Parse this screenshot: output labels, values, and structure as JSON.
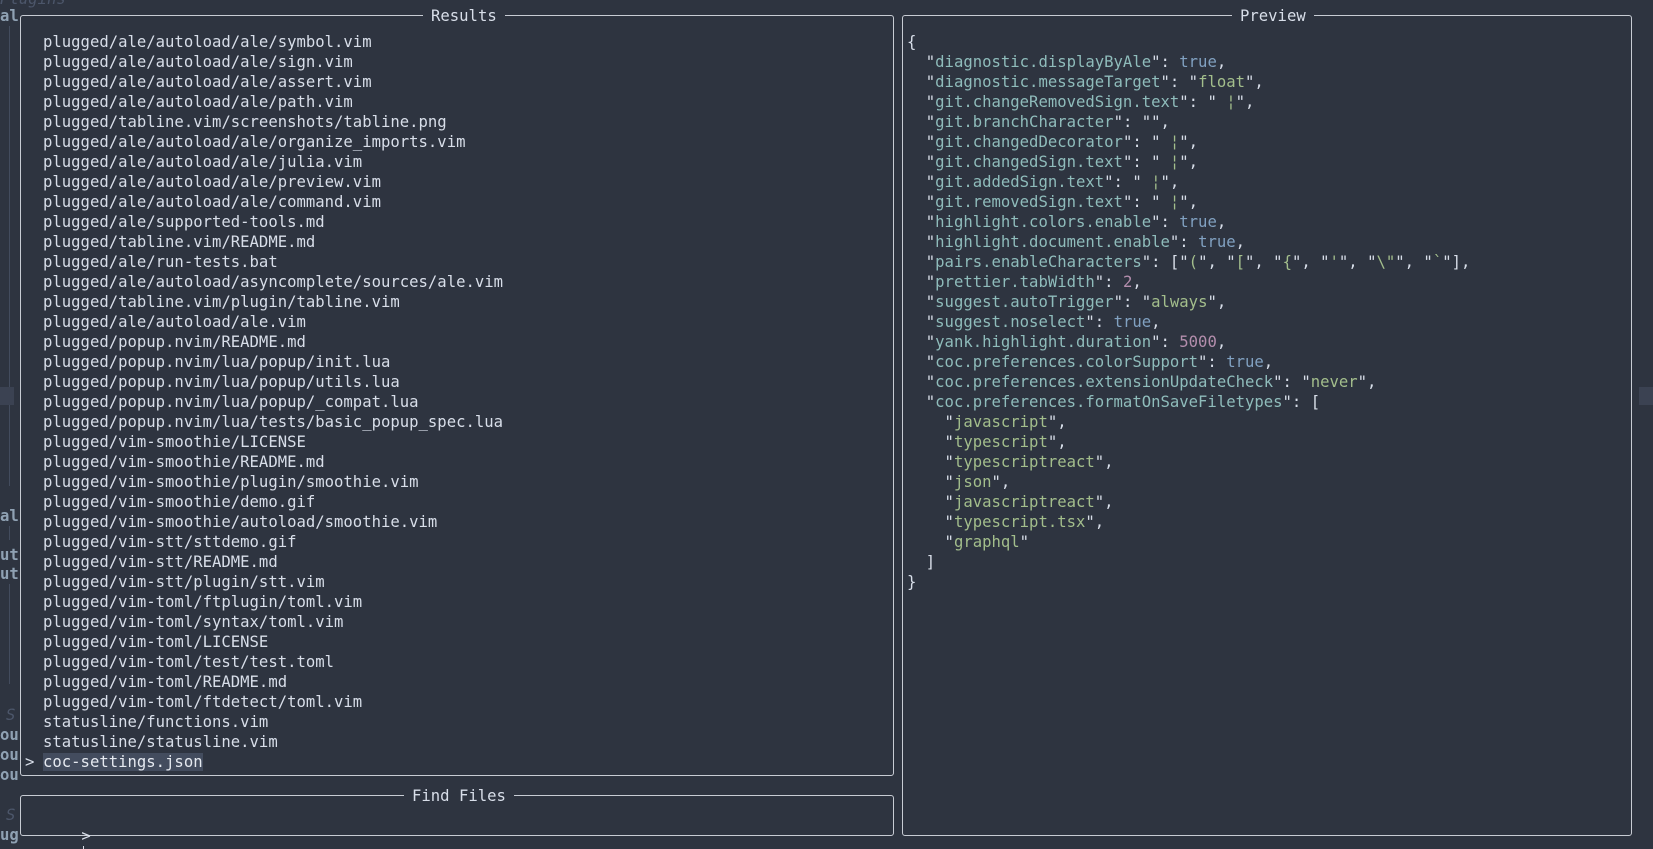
{
  "background_fragments": {
    "top": "Plugins",
    "a": "al",
    "b": "al",
    "c": "ut",
    "d": "ut",
    "e": "S",
    "f": "ou",
    "g": "ou",
    "h": "ou",
    "i": "S",
    "j": "ug"
  },
  "results": {
    "title": "Results",
    "caret": ">",
    "items": [
      "plugged/ale/autoload/ale/symbol.vim",
      "plugged/ale/autoload/ale/sign.vim",
      "plugged/ale/autoload/ale/assert.vim",
      "plugged/ale/autoload/ale/path.vim",
      "plugged/tabline.vim/screenshots/tabline.png",
      "plugged/ale/autoload/ale/organize_imports.vim",
      "plugged/ale/autoload/ale/julia.vim",
      "plugged/ale/autoload/ale/preview.vim",
      "plugged/ale/autoload/ale/command.vim",
      "plugged/ale/supported-tools.md",
      "plugged/tabline.vim/README.md",
      "plugged/ale/run-tests.bat",
      "plugged/ale/autoload/asyncomplete/sources/ale.vim",
      "plugged/tabline.vim/plugin/tabline.vim",
      "plugged/ale/autoload/ale.vim",
      "plugged/popup.nvim/README.md",
      "plugged/popup.nvim/lua/popup/init.lua",
      "plugged/popup.nvim/lua/popup/utils.lua",
      "plugged/popup.nvim/lua/popup/_compat.lua",
      "plugged/popup.nvim/lua/tests/basic_popup_spec.lua",
      "plugged/vim-smoothie/LICENSE",
      "plugged/vim-smoothie/README.md",
      "plugged/vim-smoothie/plugin/smoothie.vim",
      "plugged/vim-smoothie/demo.gif",
      "plugged/vim-smoothie/autoload/smoothie.vim",
      "plugged/vim-stt/sttdemo.gif",
      "plugged/vim-stt/README.md",
      "plugged/vim-stt/plugin/stt.vim",
      "plugged/vim-toml/ftplugin/toml.vim",
      "plugged/vim-toml/syntax/toml.vim",
      "plugged/vim-toml/LICENSE",
      "plugged/vim-toml/test/test.toml",
      "plugged/vim-toml/README.md",
      "plugged/vim-toml/ftdetect/toml.vim",
      "statusline/functions.vim",
      "statusline/statusline.vim",
      "coc-settings.json"
    ],
    "selected_index": 36
  },
  "preview": {
    "title": "Preview",
    "lines": [
      [
        [
          "p",
          "{"
        ]
      ],
      [
        [
          "p",
          "  \""
        ],
        [
          "k",
          "diagnostic.displayByAle"
        ],
        [
          "p",
          "\": "
        ],
        [
          "b",
          "true"
        ],
        [
          "p",
          ","
        ]
      ],
      [
        [
          "p",
          "  \""
        ],
        [
          "k",
          "diagnostic.messageTarget"
        ],
        [
          "p",
          "\": \""
        ],
        [
          "s",
          "float"
        ],
        [
          "p",
          "\","
        ]
      ],
      [
        [
          "p",
          "  \""
        ],
        [
          "k",
          "git.changeRemovedSign.text"
        ],
        [
          "p",
          "\": \""
        ],
        [
          "s",
          " ¦"
        ],
        [
          "p",
          "\","
        ]
      ],
      [
        [
          "p",
          "  \""
        ],
        [
          "k",
          "git.branchCharacter"
        ],
        [
          "p",
          "\": \""
        ],
        [
          "s",
          ""
        ],
        [
          "p",
          "\","
        ]
      ],
      [
        [
          "p",
          "  \""
        ],
        [
          "k",
          "git.changedDecorator"
        ],
        [
          "p",
          "\": \""
        ],
        [
          "s",
          " ¦"
        ],
        [
          "p",
          "\","
        ]
      ],
      [
        [
          "p",
          "  \""
        ],
        [
          "k",
          "git.changedSign.text"
        ],
        [
          "p",
          "\": \""
        ],
        [
          "s",
          " ¦"
        ],
        [
          "p",
          "\","
        ]
      ],
      [
        [
          "p",
          "  \""
        ],
        [
          "k",
          "git.addedSign.text"
        ],
        [
          "p",
          "\": \""
        ],
        [
          "s",
          " ¦"
        ],
        [
          "p",
          "\","
        ]
      ],
      [
        [
          "p",
          "  \""
        ],
        [
          "k",
          "git.removedSign.text"
        ],
        [
          "p",
          "\": \""
        ],
        [
          "s",
          " ¦"
        ],
        [
          "p",
          "\","
        ]
      ],
      [
        [
          "p",
          "  \""
        ],
        [
          "k",
          "highlight.colors.enable"
        ],
        [
          "p",
          "\": "
        ],
        [
          "b",
          "true"
        ],
        [
          "p",
          ","
        ]
      ],
      [
        [
          "p",
          "  \""
        ],
        [
          "k",
          "highlight.document.enable"
        ],
        [
          "p",
          "\": "
        ],
        [
          "b",
          "true"
        ],
        [
          "p",
          ","
        ]
      ],
      [
        [
          "p",
          "  \""
        ],
        [
          "k",
          "pairs.enableCharacters"
        ],
        [
          "p",
          "\": [\""
        ],
        [
          "s",
          "("
        ],
        [
          "p",
          "\", \""
        ],
        [
          "s",
          "["
        ],
        [
          "p",
          "\", \""
        ],
        [
          "s",
          "{"
        ],
        [
          "p",
          "\", \""
        ],
        [
          "s",
          "'"
        ],
        [
          "p",
          "\", \""
        ],
        [
          "s",
          "\\\""
        ],
        [
          "p",
          "\", \""
        ],
        [
          "s",
          "`"
        ],
        [
          "p",
          "\"],"
        ]
      ],
      [
        [
          "p",
          "  \""
        ],
        [
          "k",
          "prettier.tabWidth"
        ],
        [
          "p",
          "\": "
        ],
        [
          "n",
          "2"
        ],
        [
          "p",
          ","
        ]
      ],
      [
        [
          "p",
          "  \""
        ],
        [
          "k",
          "suggest.autoTrigger"
        ],
        [
          "p",
          "\": \""
        ],
        [
          "s",
          "always"
        ],
        [
          "p",
          "\","
        ]
      ],
      [
        [
          "p",
          "  \""
        ],
        [
          "k",
          "suggest.noselect"
        ],
        [
          "p",
          "\": "
        ],
        [
          "b",
          "true"
        ],
        [
          "p",
          ","
        ]
      ],
      [
        [
          "p",
          "  \""
        ],
        [
          "k",
          "yank.highlight.duration"
        ],
        [
          "p",
          "\": "
        ],
        [
          "n",
          "5000"
        ],
        [
          "p",
          ","
        ]
      ],
      [
        [
          "p",
          "  \""
        ],
        [
          "k",
          "coc.preferences.colorSupport"
        ],
        [
          "p",
          "\": "
        ],
        [
          "b",
          "true"
        ],
        [
          "p",
          ","
        ]
      ],
      [
        [
          "p",
          "  \""
        ],
        [
          "k",
          "coc.preferences.extensionUpdateCheck"
        ],
        [
          "p",
          "\": \""
        ],
        [
          "s",
          "never"
        ],
        [
          "p",
          "\","
        ]
      ],
      [
        [
          "p",
          "  \""
        ],
        [
          "k",
          "coc.preferences.formatOnSaveFiletypes"
        ],
        [
          "p",
          "\": ["
        ]
      ],
      [
        [
          "p",
          "    \""
        ],
        [
          "s",
          "javascript"
        ],
        [
          "p",
          "\","
        ]
      ],
      [
        [
          "p",
          "    \""
        ],
        [
          "s",
          "typescript"
        ],
        [
          "p",
          "\","
        ]
      ],
      [
        [
          "p",
          "    \""
        ],
        [
          "s",
          "typescriptreact"
        ],
        [
          "p",
          "\","
        ]
      ],
      [
        [
          "p",
          "    \""
        ],
        [
          "s",
          "json"
        ],
        [
          "p",
          "\","
        ]
      ],
      [
        [
          "p",
          "    \""
        ],
        [
          "s",
          "javascriptreact"
        ],
        [
          "p",
          "\","
        ]
      ],
      [
        [
          "p",
          "    \""
        ],
        [
          "s",
          "typescript.tsx"
        ],
        [
          "p",
          "\","
        ]
      ],
      [
        [
          "p",
          "    \""
        ],
        [
          "s",
          "graphql"
        ],
        [
          "p",
          "\""
        ]
      ],
      [
        [
          "p",
          "  ]"
        ]
      ],
      [
        [
          "p",
          "}"
        ]
      ]
    ]
  },
  "prompt": {
    "title": "Find Files",
    "prefix": ">",
    "query": ""
  }
}
